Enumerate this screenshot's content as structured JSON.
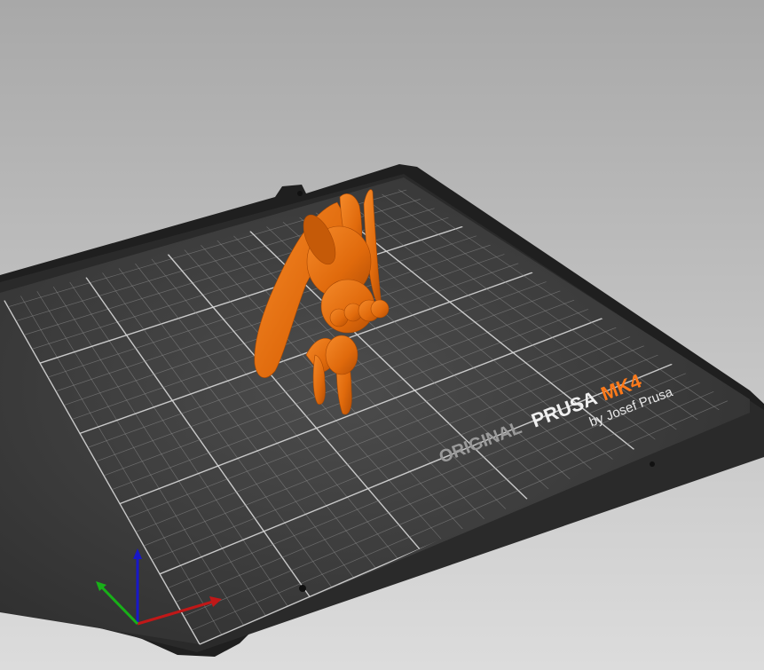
{
  "viewport": {
    "background_top": "#a9a9a9",
    "background_bottom": "#dcdcdc"
  },
  "bed": {
    "brand_prefix": "ORIGINAL",
    "brand_name": "PRUSA",
    "model": "MK4",
    "byline": "by Josef Prusa",
    "plate_color": "#3a3a3a",
    "frame_color": "#262626",
    "grid_color": "#8a8a8a",
    "accent_color": "#ff7a1a"
  },
  "model": {
    "color": "#e06a0c"
  },
  "axes": {
    "x_color": "#c01818",
    "y_color": "#18b018",
    "z_color": "#1818c8"
  }
}
